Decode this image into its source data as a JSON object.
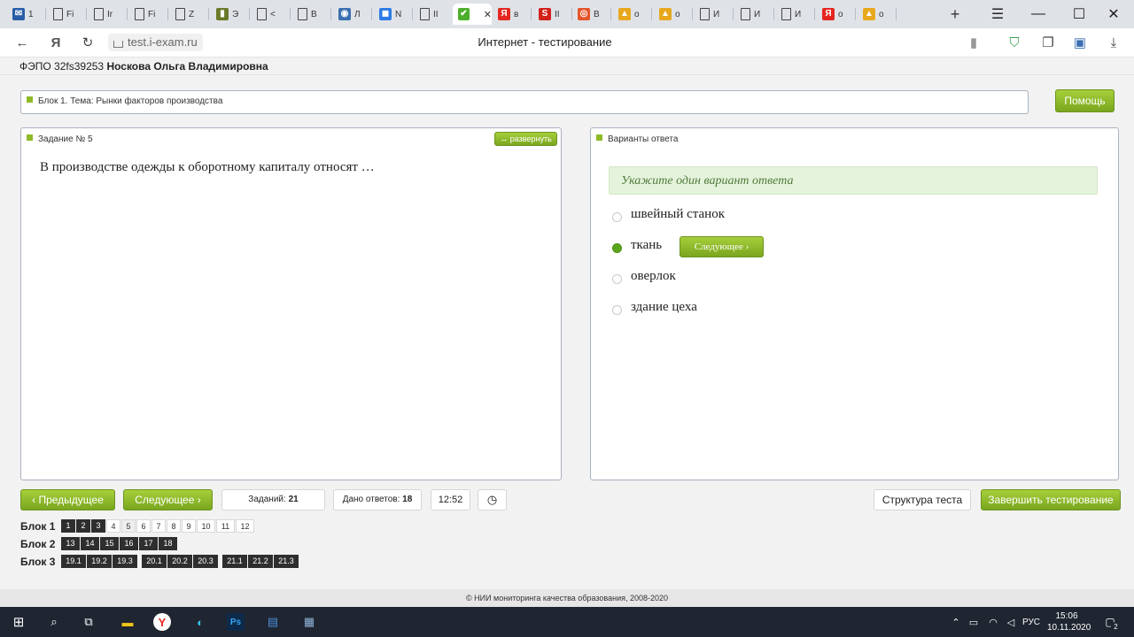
{
  "browser": {
    "tabs": [
      {
        "label": "1",
        "favicon": "mail-icon",
        "color": "#2b5ea8",
        "glyph": "✉"
      },
      {
        "label": "Fi",
        "favicon": "document-icon",
        "color": "#444",
        "glyph": ""
      },
      {
        "label": "Ir",
        "favicon": "document-icon",
        "color": "#444",
        "glyph": ""
      },
      {
        "label": "Fi",
        "favicon": "document-icon",
        "color": "#444",
        "glyph": ""
      },
      {
        "label": "Z",
        "favicon": "document-icon",
        "color": "#444",
        "glyph": ""
      },
      {
        "label": "Э",
        "favicon": "books-icon",
        "color": "#6a7a2a",
        "glyph": "▮"
      },
      {
        "label": "<",
        "favicon": "document-icon",
        "color": "#444",
        "glyph": ""
      },
      {
        "label": "B",
        "favicon": "document-icon",
        "color": "#444",
        "glyph": ""
      },
      {
        "label": "Л",
        "favicon": "globe-icon",
        "color": "#3a6fb0",
        "glyph": "◉"
      },
      {
        "label": "N",
        "favicon": "chat-icon",
        "color": "#2d7be5",
        "glyph": "◼"
      },
      {
        "label": "II",
        "favicon": "document-icon",
        "color": "#444",
        "glyph": ""
      },
      {
        "label": "",
        "favicon": "exam-icon",
        "color": "#4caf2a",
        "glyph": "✔"
      },
      {
        "label": "в",
        "favicon": "yandex-icon",
        "color": "#e52620",
        "glyph": "Я"
      },
      {
        "label": "II",
        "favicon": "s-icon",
        "color": "#d4201a",
        "glyph": "S"
      },
      {
        "label": "В",
        "favicon": "lifebuoy-icon",
        "color": "#e5552a",
        "glyph": "◎"
      },
      {
        "label": "о",
        "favicon": "image-icon",
        "color": "#e7a81e",
        "glyph": "▲"
      },
      {
        "label": "о",
        "favicon": "image-icon",
        "color": "#e7a81e",
        "glyph": "▲"
      },
      {
        "label": "И",
        "favicon": "document-icon",
        "color": "#444",
        "glyph": ""
      },
      {
        "label": "И",
        "favicon": "document-icon",
        "color": "#444",
        "glyph": ""
      },
      {
        "label": "И",
        "favicon": "document-icon",
        "color": "#444",
        "glyph": ""
      },
      {
        "label": "о",
        "favicon": "yandex-icon",
        "color": "#e52620",
        "glyph": "Я"
      },
      {
        "label": "о",
        "favicon": "image-icon",
        "color": "#e7a81e",
        "glyph": "▲"
      }
    ],
    "url": "test.i-exam.ru",
    "page_title": "Интернет - тестирование"
  },
  "user_line": {
    "code": "ФЭПО 32fs39253",
    "name": "Носкова Ольга Владимировна"
  },
  "topic": {
    "label": "Блок 1. Тема: Рынки факторов производства",
    "help_button": "Помощь"
  },
  "task": {
    "header": "Задание № 5",
    "expand_button": "развернуть",
    "question": "В производстве одежды к оборотному капиталу относят …"
  },
  "answers": {
    "header": "Варианты ответа",
    "instruction": "Укажите один вариант ответа",
    "options": [
      {
        "text": "швейный станок",
        "selected": false
      },
      {
        "text": "ткань",
        "selected": true
      },
      {
        "text": "оверлок",
        "selected": false
      },
      {
        "text": "здание цеха",
        "selected": false
      }
    ],
    "next_inline": "Следующее"
  },
  "controls": {
    "prev": "Предыдущее",
    "next": "Следующее",
    "tasks_label": "Заданий:",
    "tasks_count": "21",
    "answered_label": "Дано ответов:",
    "answered_count": "18",
    "timer": "12:52",
    "structure": "Структура теста",
    "finish": "Завершить тестирование"
  },
  "blocks": [
    {
      "label": "Блок 1",
      "items": [
        {
          "n": "1",
          "answered": true
        },
        {
          "n": "2",
          "answered": true
        },
        {
          "n": "3",
          "answered": true
        },
        {
          "n": "4",
          "answered": false
        },
        {
          "n": "5",
          "answered": false,
          "current": true
        },
        {
          "n": "6",
          "answered": false
        },
        {
          "n": "7",
          "answered": false
        },
        {
          "n": "8",
          "answered": false
        },
        {
          "n": "9",
          "answered": false
        },
        {
          "n": "10",
          "answered": false
        },
        {
          "n": "11",
          "answered": false
        },
        {
          "n": "12",
          "answered": false
        }
      ]
    },
    {
      "label": "Блок 2",
      "items": [
        {
          "n": "13",
          "answered": true
        },
        {
          "n": "14",
          "answered": true
        },
        {
          "n": "15",
          "answered": true
        },
        {
          "n": "16",
          "answered": true
        },
        {
          "n": "17",
          "answered": true
        },
        {
          "n": "18",
          "answered": true
        }
      ]
    },
    {
      "label": "Блок 3",
      "items": [
        {
          "n": "19.1",
          "answered": true
        },
        {
          "n": "19.2",
          "answered": true
        },
        {
          "n": "19.3",
          "answered": true
        },
        {
          "n": "20.1",
          "answered": true
        },
        {
          "n": "20.2",
          "answered": true
        },
        {
          "n": "20.3",
          "answered": true
        },
        {
          "n": "21.1",
          "answered": true
        },
        {
          "n": "21.2",
          "answered": true
        },
        {
          "n": "21.3",
          "answered": true
        }
      ]
    }
  ],
  "footer": "© НИИ мониторинга качества образования, 2008-2020",
  "taskbar": {
    "lang": "РУС",
    "time": "15:06",
    "date": "10.11.2020",
    "notifications": "2"
  },
  "colors": {
    "accent_green": "#8fba28",
    "selected_radio": "#5ba51c",
    "taskbar_bg": "#1f2531"
  }
}
